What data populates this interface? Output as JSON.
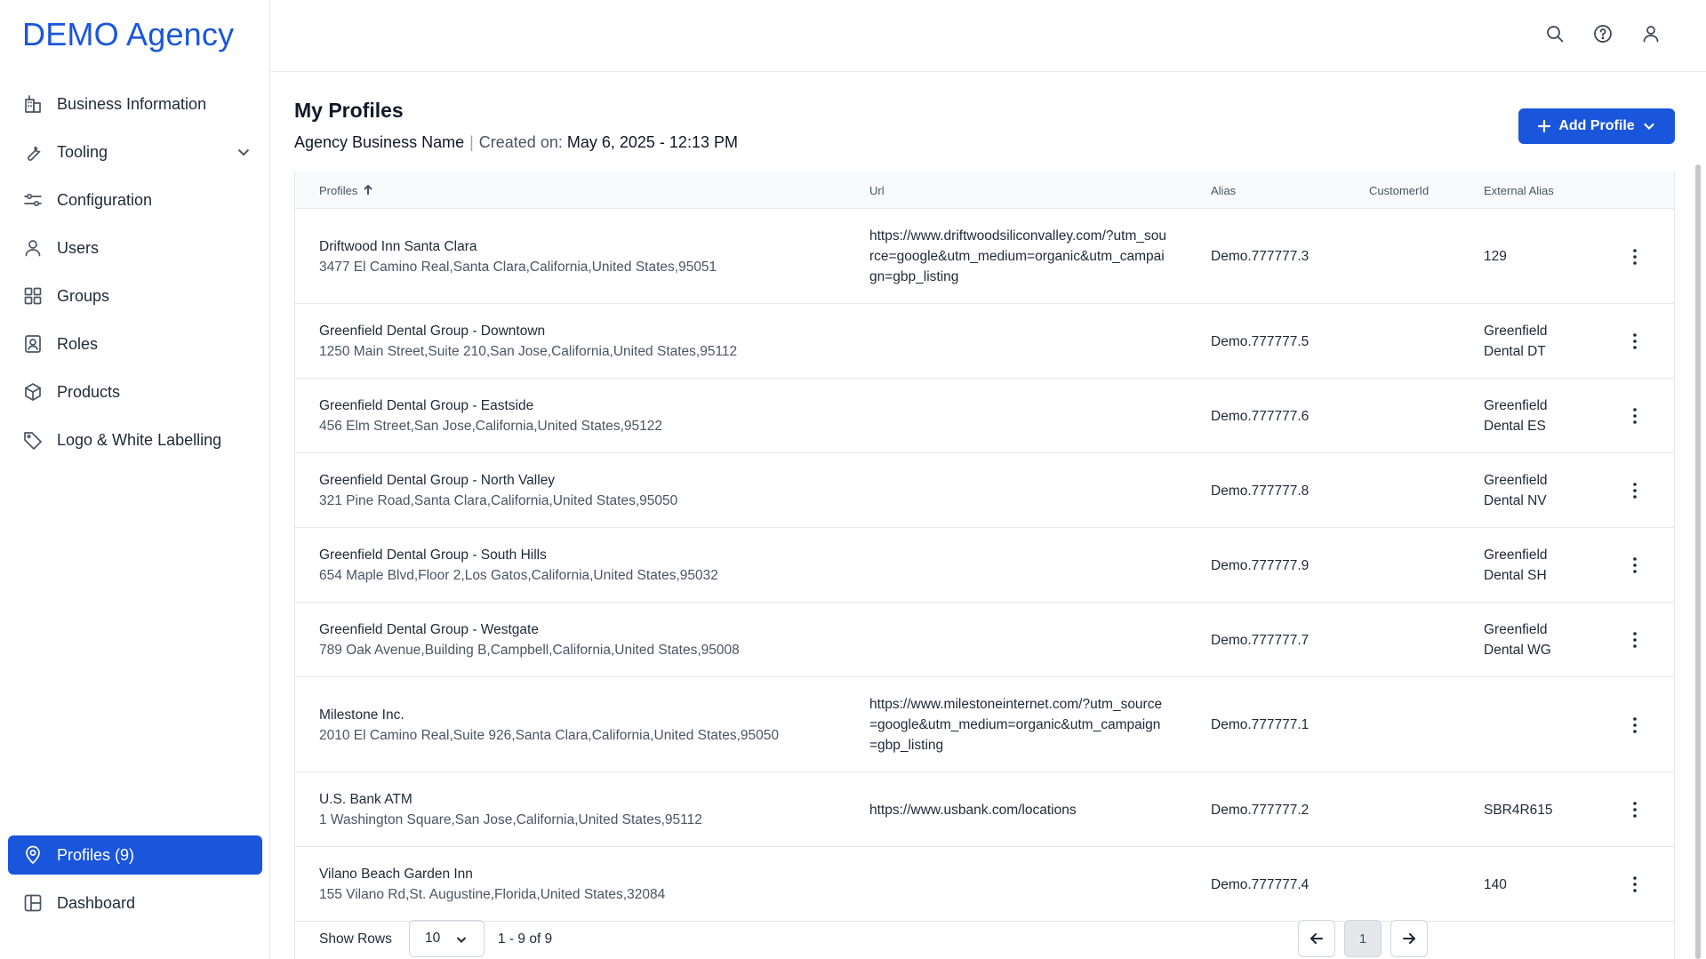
{
  "brand": "DEMO Agency",
  "sidebar": {
    "items": [
      {
        "label": "Business Information",
        "icon": "building-icon"
      },
      {
        "label": "Tooling",
        "icon": "wrench-icon"
      },
      {
        "label": "Configuration",
        "icon": "sliders-icon"
      },
      {
        "label": "Users",
        "icon": "user-icon"
      },
      {
        "label": "Groups",
        "icon": "grid-icon"
      },
      {
        "label": "Roles",
        "icon": "id-badge-icon"
      },
      {
        "label": "Products",
        "icon": "box-icon"
      },
      {
        "label": "Logo & White Labelling",
        "icon": "tag-icon"
      }
    ],
    "bottom": [
      {
        "label": "Profiles (9)",
        "icon": "location-pin-icon",
        "active": true
      },
      {
        "label": "Dashboard",
        "icon": "layout-icon"
      }
    ]
  },
  "header": {
    "icons": [
      "search-icon",
      "help-icon",
      "user-icon"
    ]
  },
  "page": {
    "title": "My Profiles",
    "business_name": "Agency Business Name",
    "created_label": "Created on:",
    "created_value": "May 6, 2025 - 12:13 PM",
    "add_button": "Add Profile"
  },
  "table": {
    "headers": {
      "profiles": "Profiles",
      "url": "Url",
      "alias": "Alias",
      "customer_id": "CustomerId",
      "external_alias": "External Alias"
    },
    "rows": [
      {
        "name": "Driftwood Inn Santa Clara",
        "address": "3477 El Camino Real,Santa Clara,California,United States,95051",
        "url": "https://www.driftwoodsiliconvalley.com/?utm_source=google&utm_medium=organic&utm_campaign=gbp_listing",
        "alias": "Demo.777777.3",
        "customer_id": "",
        "external_alias": "129"
      },
      {
        "name": "Greenfield Dental Group - Downtown",
        "address": "1250 Main Street,Suite 210,San Jose,California,United States,95112",
        "url": "",
        "alias": "Demo.777777.5",
        "customer_id": "",
        "external_alias": "Greenfield Dental DT"
      },
      {
        "name": "Greenfield Dental Group - Eastside",
        "address": "456 Elm Street,San Jose,California,United States,95122",
        "url": "",
        "alias": "Demo.777777.6",
        "customer_id": "",
        "external_alias": "Greenfield Dental ES"
      },
      {
        "name": "Greenfield Dental Group - North Valley",
        "address": "321 Pine Road,Santa Clara,California,United States,95050",
        "url": "",
        "alias": "Demo.777777.8",
        "customer_id": "",
        "external_alias": "Greenfield Dental NV"
      },
      {
        "name": "Greenfield Dental Group - South Hills",
        "address": "654 Maple Blvd,Floor 2,Los Gatos,California,United States,95032",
        "url": "",
        "alias": "Demo.777777.9",
        "customer_id": "",
        "external_alias": "Greenfield Dental SH"
      },
      {
        "name": "Greenfield Dental Group - Westgate",
        "address": "789 Oak Avenue,Building B,Campbell,California,United States,95008",
        "url": "",
        "alias": "Demo.777777.7",
        "customer_id": "",
        "external_alias": "Greenfield Dental WG"
      },
      {
        "name": "Milestone Inc.",
        "address": "2010 El Camino Real,Suite 926,Santa Clara,California,United States,95050",
        "url": "https://www.milestoneinternet.com/?utm_source=google&utm_medium=organic&utm_campaign=gbp_listing",
        "alias": "Demo.777777.1",
        "customer_id": "",
        "external_alias": ""
      },
      {
        "name": "U.S. Bank ATM",
        "address": "1 Washington Square,San Jose,California,United States,95112",
        "url": "https://www.usbank.com/locations",
        "alias": "Demo.777777.2",
        "customer_id": "",
        "external_alias": "SBR4R615"
      },
      {
        "name": "Vilano Beach Garden Inn",
        "address": "155 Vilano Rd,St. Augustine,Florida,United States,32084",
        "url": "",
        "alias": "Demo.777777.4",
        "customer_id": "",
        "external_alias": "140"
      }
    ]
  },
  "pagination": {
    "show_rows_label": "Show Rows",
    "rows_per_page": "10",
    "range": "1 - 9 of 9",
    "current_page": "1"
  },
  "colors": {
    "accent": "#1a56db",
    "border": "#e5e7eb",
    "text": "#1f2937"
  }
}
